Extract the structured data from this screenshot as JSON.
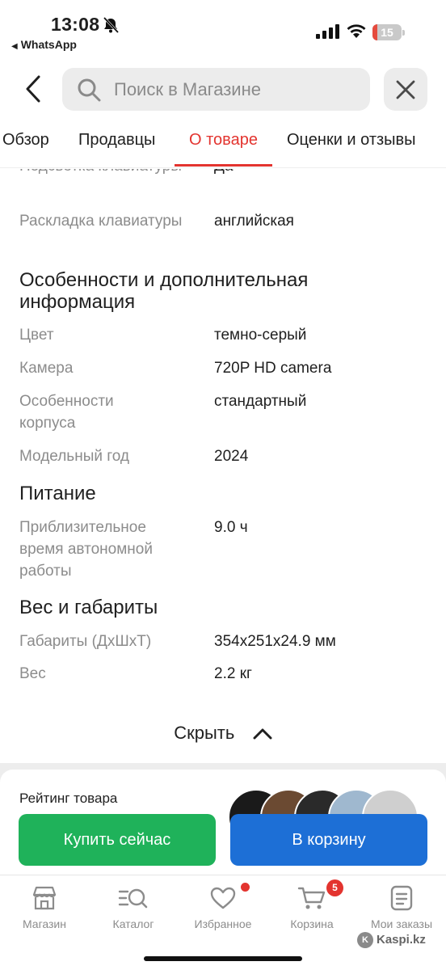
{
  "status_bar": {
    "time": "13:08",
    "back_app": "WhatsApp",
    "battery": "15",
    "battery_color": "#e54b3e"
  },
  "search": {
    "placeholder": "Поиск в Магазине"
  },
  "tabs": [
    {
      "label": "Обзор",
      "active": false
    },
    {
      "label": "Продавцы",
      "active": false
    },
    {
      "label": "О товаре",
      "active": true
    },
    {
      "label": "Оценки и отзывы",
      "active": false
    }
  ],
  "specs": {
    "backlight": {
      "label": "Подсветка клавиатуры",
      "value": "Да"
    },
    "layout": {
      "label": "Раскладка клавиатуры",
      "value": "английская"
    },
    "features_title": "Особенности и дополнительная информация",
    "color": {
      "label": "Цвет",
      "value": "темно-серый"
    },
    "camera": {
      "label": "Камера",
      "value": "720P HD camera"
    },
    "body": {
      "label": "Особенности корпуса",
      "value": "стандартный"
    },
    "year": {
      "label": "Модельный год",
      "value": "2024"
    },
    "power_title": "Питание",
    "battery_life": {
      "label": "Приблизительное время автономной работы",
      "value": "9.0 ч"
    },
    "dimensions_title": "Вес и габариты",
    "dimensions": {
      "label": "Габариты (ДхШхТ)",
      "value": "354x251x24.9 мм"
    },
    "weight": {
      "label": "Вес",
      "value": "2.2 кг"
    }
  },
  "hide_label": "Скрыть",
  "rating_title": "Рейтинг товара",
  "actions": {
    "buy_now": "Купить сейчас",
    "to_cart": "В корзину"
  },
  "colors": {
    "accent": "#e3342f",
    "buy": "#1fb25a",
    "cart": "#1d6fd6"
  },
  "bottom_nav": [
    {
      "label": "Магазин",
      "icon": "store-icon"
    },
    {
      "label": "Каталог",
      "icon": "catalog-icon"
    },
    {
      "label": "Избранное",
      "icon": "heart-icon"
    },
    {
      "label": "Корзина",
      "icon": "cart-icon"
    },
    {
      "label": "Мои заказы",
      "icon": "orders-icon"
    }
  ],
  "cart_count": "5",
  "watermark": "Kaspi.kz"
}
